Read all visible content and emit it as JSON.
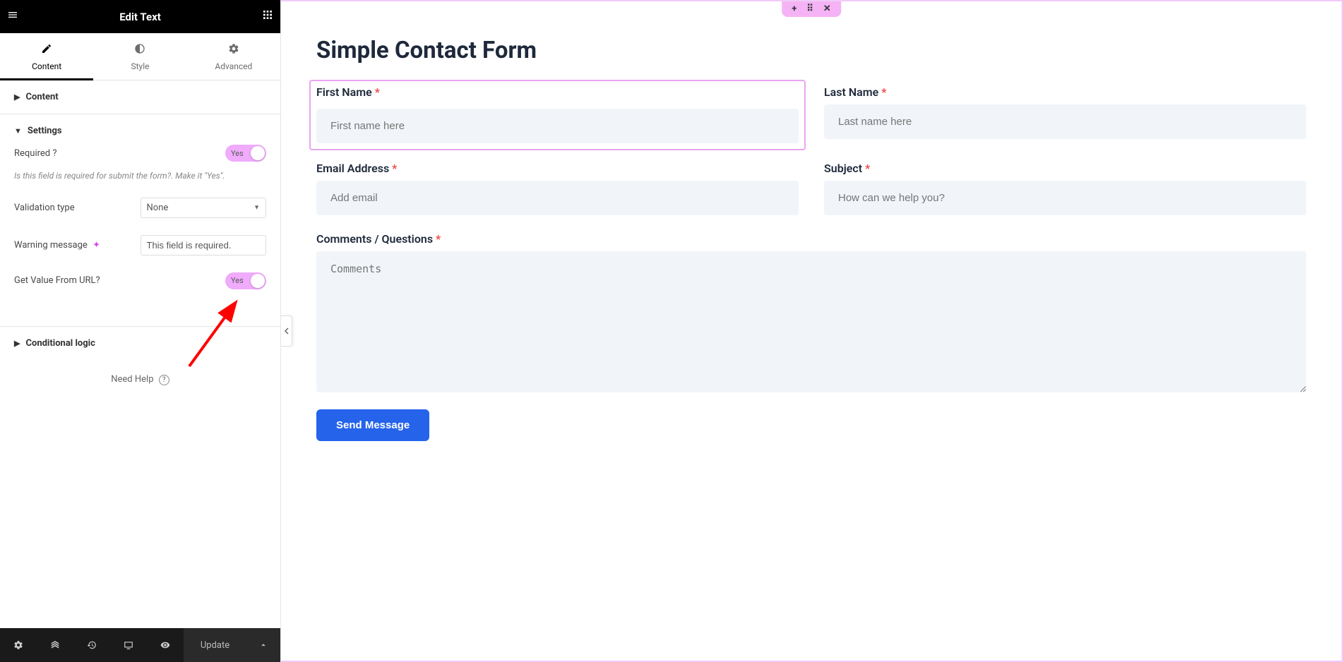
{
  "header": {
    "title": "Edit Text"
  },
  "tabs": {
    "content": "Content",
    "style": "Style",
    "advanced": "Advanced"
  },
  "panels": {
    "content": "Content",
    "settings": "Settings",
    "conditional": "Conditional logic"
  },
  "settings": {
    "required_label": "Required ?",
    "required_value": "Yes",
    "required_help": "Is this field is required for submit the form?. Make it \"Yes\".",
    "validation_label": "Validation type",
    "validation_value": "None",
    "warning_label": "Warning message",
    "warning_value": "This field is required.",
    "url_value_label": "Get Value From URL?",
    "url_value_value": "Yes"
  },
  "help": {
    "need_help": "Need Help"
  },
  "footer": {
    "update": "Update"
  },
  "form": {
    "title": "Simple Contact Form",
    "fields": {
      "first_name": {
        "label": "First Name",
        "placeholder": "First name here"
      },
      "last_name": {
        "label": "Last Name",
        "placeholder": "Last name here"
      },
      "email": {
        "label": "Email Address",
        "placeholder": "Add email"
      },
      "subject": {
        "label": "Subject",
        "placeholder": "How can we help you?"
      },
      "comments": {
        "label": "Comments / Questions",
        "placeholder": "Comments"
      }
    },
    "submit": "Send Message"
  }
}
